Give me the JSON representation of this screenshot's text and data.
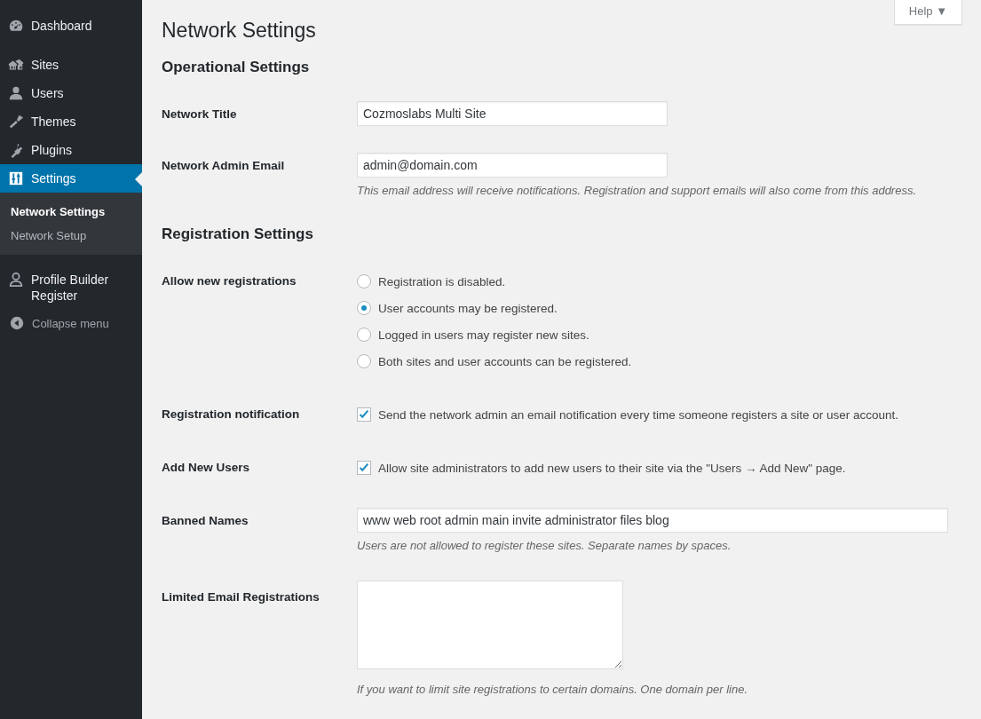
{
  "sidebar": {
    "items": [
      {
        "label": "Dashboard",
        "selected": false
      },
      {
        "label": "Sites",
        "selected": false
      },
      {
        "label": "Users",
        "selected": false
      },
      {
        "label": "Themes",
        "selected": false
      },
      {
        "label": "Plugins",
        "selected": false
      },
      {
        "label": "Settings",
        "selected": true,
        "submenu": [
          {
            "label": "Network Settings",
            "selected": true
          },
          {
            "label": "Network Setup",
            "selected": false
          }
        ]
      },
      {
        "label": "Profile Builder Register",
        "selected": false
      }
    ],
    "collapse": "Collapse menu"
  },
  "help_button": "Help ▼",
  "page_title": "Network Settings",
  "sections": [
    {
      "heading": "Operational Settings",
      "rows": [
        {
          "label": "Network Title",
          "kind": "text",
          "value": "Cozmoslabs Multi Site"
        },
        {
          "label": "Network Admin Email",
          "kind": "text",
          "value": "admin@domain.com",
          "description": "This email address will receive notifications. Registration and support emails will also come from this address."
        }
      ]
    },
    {
      "heading": "Registration Settings",
      "rows": [
        {
          "label": "Allow new registrations",
          "kind": "radio",
          "options": [
            {
              "label": "Registration is disabled.",
              "selected": false
            },
            {
              "label": "User accounts may be registered.",
              "selected": true
            },
            {
              "label": "Logged in users may register new sites.",
              "selected": false
            },
            {
              "label": "Both sites and user accounts can be registered.",
              "selected": false
            }
          ]
        },
        {
          "label": "Registration notification",
          "kind": "checkbox",
          "checked": true,
          "text": "Send the network admin an email notification every time someone registers a site or user account."
        },
        {
          "label": "Add New Users",
          "kind": "checkbox",
          "checked": true,
          "text": "Allow site administrators to add new users to their site via the \"Users → Add New\" page."
        },
        {
          "label": "Banned Names",
          "kind": "wide-text",
          "value": "www web root admin main invite administrator files blog",
          "description": "Users are not allowed to register these sites. Separate names by spaces."
        },
        {
          "label": "Limited Email Registrations",
          "kind": "textarea",
          "description": "If you want to limit site registrations to certain domains. One domain per line."
        }
      ]
    }
  ]
}
